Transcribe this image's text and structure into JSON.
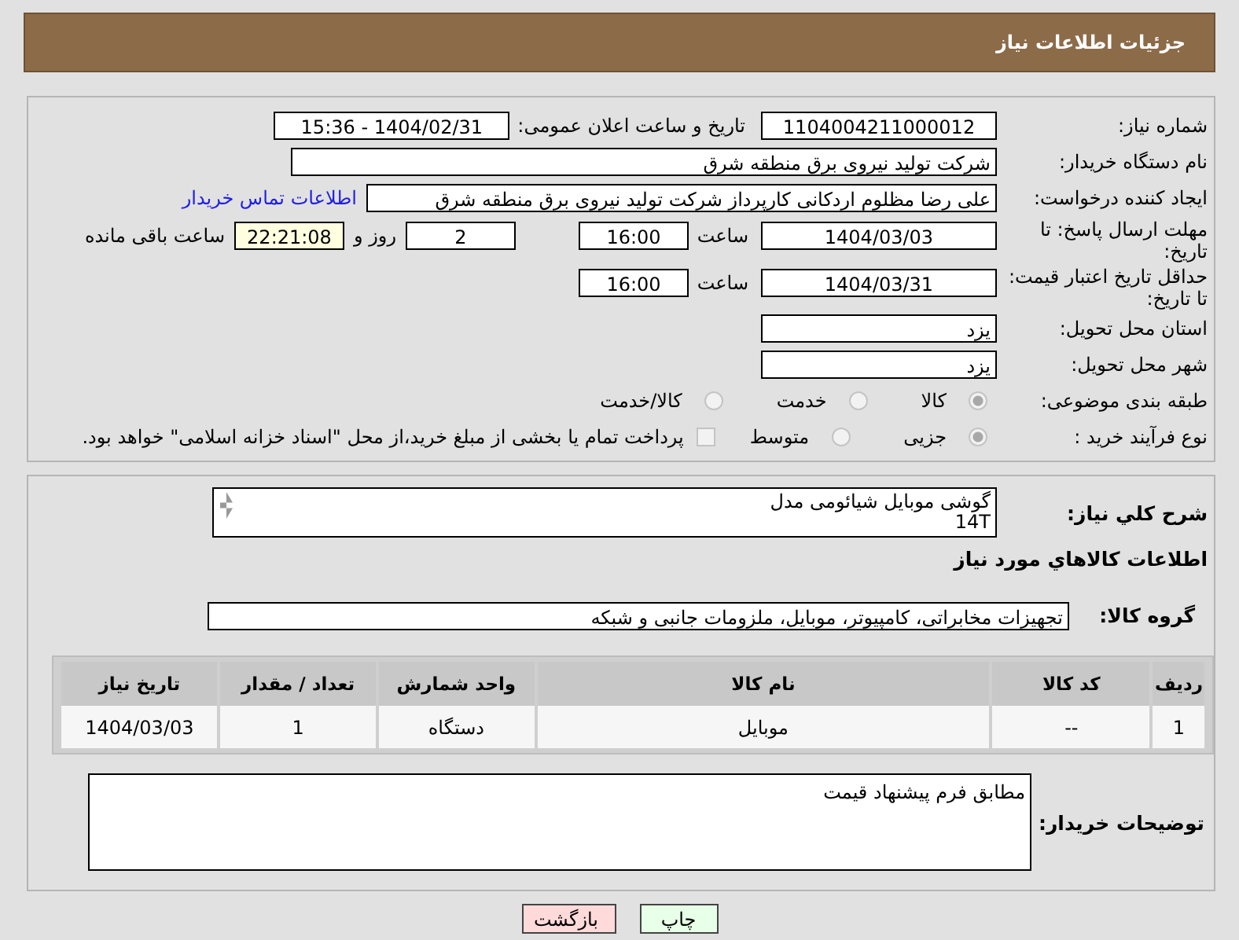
{
  "header": {
    "title": "جزئیات اطلاعات نیاز"
  },
  "details": {
    "need_number": {
      "label": "شماره نیاز:",
      "value": "1104004211000012"
    },
    "announce": {
      "label": "تاریخ و ساعت اعلان عمومی:",
      "value": "1404/02/31 - 15:36"
    },
    "buyer": {
      "label": "نام دستگاه خریدار:",
      "value": "شرکت تولید نیروی برق منطقه شرق"
    },
    "creator": {
      "label": "ایجاد کننده درخواست:",
      "value": "علی رضا مظلوم اردکانی کارپرداز شرکت تولید نیروی برق منطقه شرق",
      "link": "اطلاعات تماس خریدار"
    },
    "deadline": {
      "label": "مهلت ارسال پاسخ: تا تاریخ:",
      "date": "1404/03/03",
      "time_label": "ساعت",
      "time": "16:00",
      "days": "2",
      "days_label": "روز و",
      "remaining": "22:21:08",
      "remaining_label": "ساعت باقی مانده"
    },
    "validity": {
      "label": "حداقل تاریخ اعتبار قیمت: تا تاریخ:",
      "date": "1404/03/31",
      "time_label": "ساعت",
      "time": "16:00"
    },
    "province": {
      "label": "استان محل تحویل:",
      "value": "یزد"
    },
    "city": {
      "label": "شهر محل تحویل:",
      "value": "یزد"
    },
    "category": {
      "label": "طبقه بندی موضوعی:",
      "options": [
        {
          "label": "کالا",
          "selected": true
        },
        {
          "label": "خدمت",
          "selected": false
        },
        {
          "label": "کالا/خدمت",
          "selected": false
        }
      ]
    },
    "process": {
      "label": "نوع فرآیند خرید :",
      "options": [
        {
          "label": "جزیی",
          "selected": true
        },
        {
          "label": "متوسط",
          "selected": false
        }
      ],
      "payment": {
        "label": "پرداخت تمام یا بخشی از مبلغ خرید،از محل \"اسناد خزانه اسلامی\" خواهد بود.",
        "checked": false
      }
    }
  },
  "summary": {
    "label": "شرح کلي نياز:",
    "value": "گوشی موبایل شیائومی مدل\n14T"
  },
  "goods_heading": "اطلاعات كالاهاي مورد نياز",
  "goods_group": {
    "label": "گروه كالا:",
    "value": "تجهیزات مخابراتی، کامپیوتر، موبایل، ملزومات جانبی و شبکه"
  },
  "table": {
    "columns": [
      "ردیف",
      "کد کالا",
      "نام کالا",
      "واحد شمارش",
      "تعداد / مقدار",
      "تاریخ نیاز"
    ],
    "rows": [
      [
        "1",
        "--",
        "موبایل",
        "دستگاه",
        "1",
        "1404/03/03"
      ]
    ]
  },
  "notes": {
    "label": "توضیحات خریدار:",
    "value": "مطابق فرم پیشنهاد قیمت"
  },
  "buttons": [
    {
      "label": "چاپ",
      "kind": "print"
    },
    {
      "label": "بازگشت",
      "kind": "back"
    }
  ]
}
